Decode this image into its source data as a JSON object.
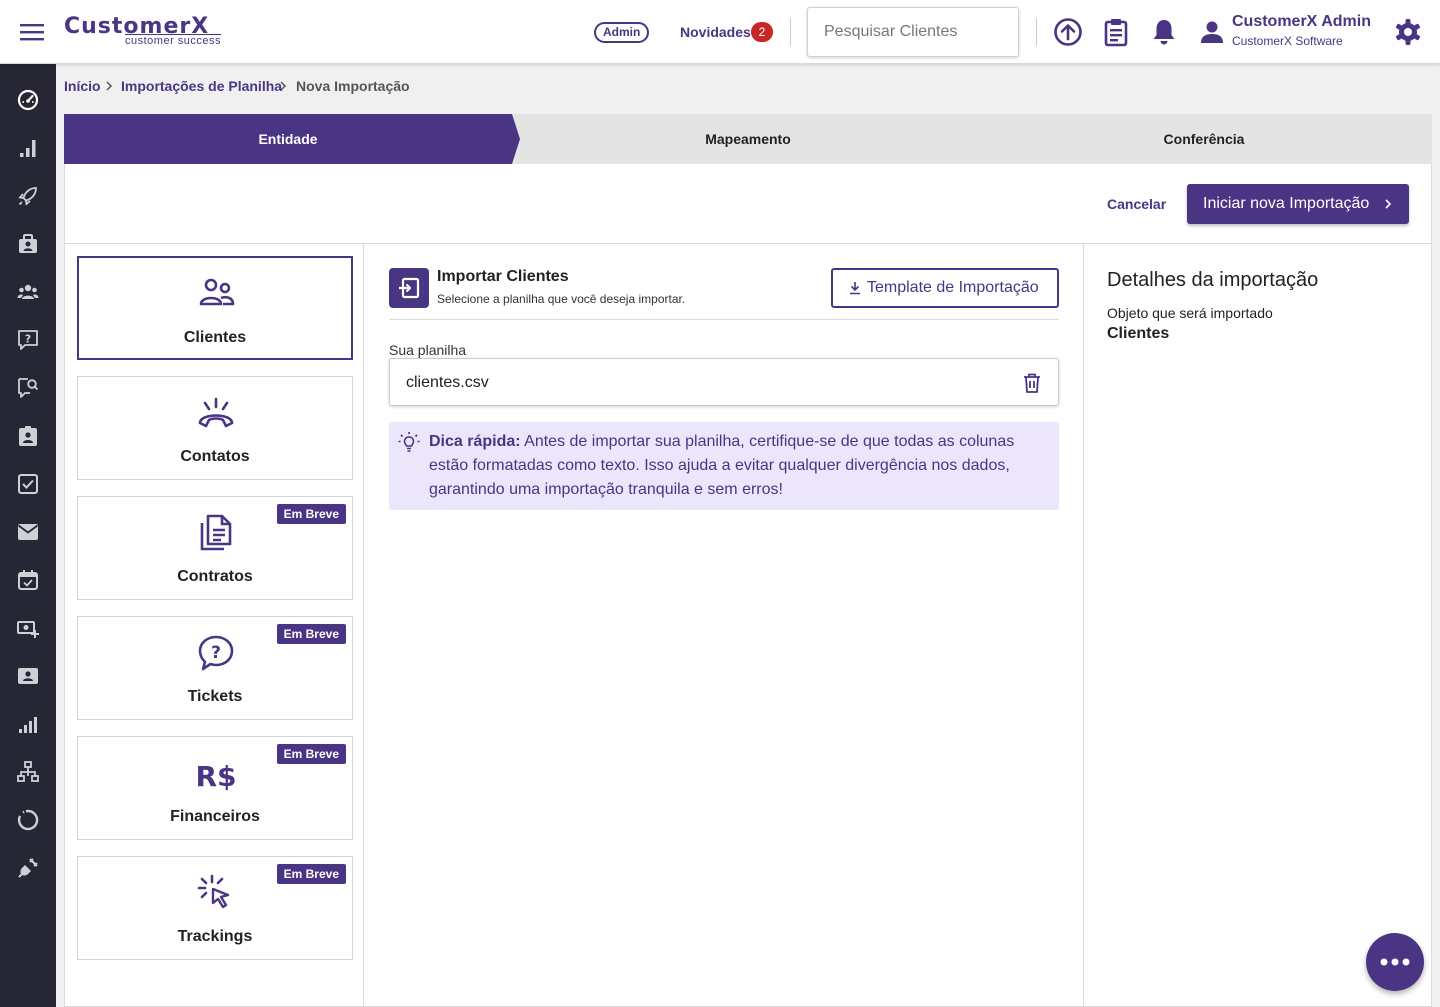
{
  "brand": {
    "logo_text": "CustomerX",
    "logo_subtitle": "customer success",
    "accent_color": "#4a3585",
    "sidebar_color": "#262634",
    "tip_background": "#ebe6fb",
    "badge_color": "#c62828"
  },
  "header": {
    "role_badge": "Admin",
    "news_label": "Novidades",
    "news_count": "2",
    "search_placeholder": "Pesquisar Clientes",
    "icons": [
      "upload-icon",
      "clipboard-icon",
      "bell-icon",
      "gear-icon"
    ],
    "user": {
      "name": "CustomerX Admin",
      "organization": "CustomerX Software"
    }
  },
  "sidebar": {
    "icons": [
      "dashboard-gauge-icon",
      "bar-chart-icon",
      "rocket-icon",
      "briefcase-icon",
      "users-group-icon",
      "help-chat-icon",
      "search-chat-icon",
      "contact-badge-icon",
      "checkbox-icon",
      "mail-icon",
      "calendar-check-icon",
      "money-add-icon",
      "id-card-icon",
      "signal-chart-icon",
      "network-icon",
      "loop-icon",
      "plug-icon"
    ]
  },
  "breadcrumb": {
    "items": [
      "Início",
      "Importações de Planilha",
      "Nova Importação"
    ]
  },
  "stepper": {
    "steps": [
      "Entidade",
      "Mapeamento",
      "Conferência"
    ],
    "active_step": "Entidade"
  },
  "actions": {
    "cancel_label": "Cancelar",
    "start_label": "Iniciar nova Importação"
  },
  "entities": {
    "items": [
      {
        "label": "Clientes",
        "icon": "people-icon",
        "selected": true,
        "badge": ""
      },
      {
        "label": "Contatos",
        "icon": "phone-ring-icon",
        "selected": false,
        "badge": ""
      },
      {
        "label": "Contratos",
        "icon": "documents-icon",
        "selected": false,
        "badge": "Em Breve"
      },
      {
        "label": "Tickets",
        "icon": "help-bubble-icon",
        "selected": false,
        "badge": "Em Breve"
      },
      {
        "label": "Financeiros",
        "icon": "currency-real-icon",
        "selected": false,
        "badge": "Em Breve"
      },
      {
        "label": "Trackings",
        "icon": "click-pointer-icon",
        "selected": false,
        "badge": "Em Breve"
      }
    ]
  },
  "import": {
    "title": "Importar Clientes",
    "subtitle": "Selecione a planilha que você deseja importar.",
    "template_button": "Template de Importação",
    "file_label": "Sua planilha",
    "file_name": "clientes.csv",
    "tip_title": "Dica rápida:",
    "tip_text": "Antes de importar sua planilha, certifique-se de que todas as colunas estão formatadas como texto. Isso ajuda a evitar qualquer divergência nos dados, garantindo uma importação tranquila e sem erros!"
  },
  "details": {
    "title": "Detalhes da importação",
    "object_label": "Objeto que será importado",
    "object_value": "Clientes"
  }
}
